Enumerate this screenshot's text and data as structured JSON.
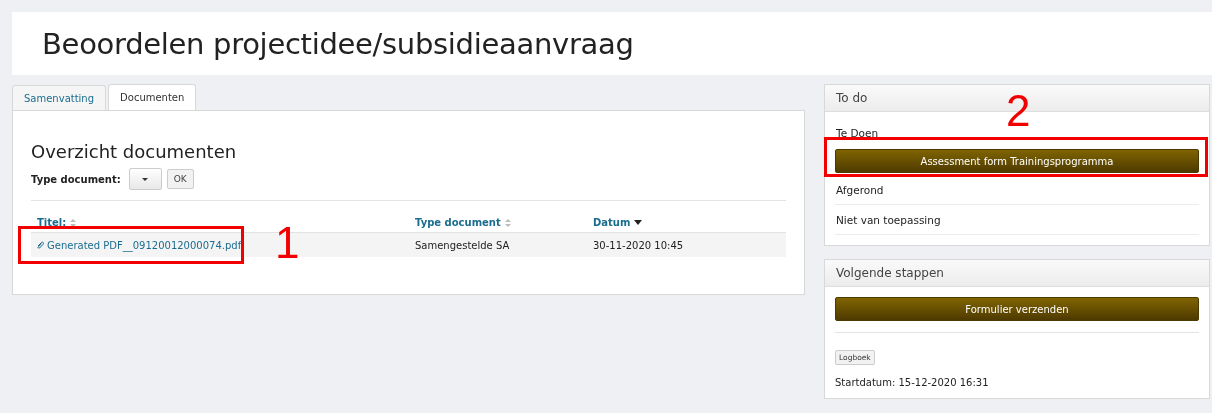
{
  "page_title": "Beoordelen projectidee/subsidieaanvraag",
  "tabs": [
    {
      "label": "Samenvatting",
      "selected": false
    },
    {
      "label": "Documenten",
      "selected": true
    }
  ],
  "documents": {
    "heading": "Overzicht documenten",
    "filter_label": "Type document:",
    "filter_button": "OK",
    "columns": [
      {
        "label": "Titel:",
        "sorted": false
      },
      {
        "label": "Type document",
        "sorted": false
      },
      {
        "label": "Datum",
        "sorted": true
      }
    ],
    "rows": [
      {
        "title": "Generated PDF__09120012000074.pdf",
        "type": "Samengestelde SA",
        "date": "30-11-2020 10:45",
        "callout": "1"
      }
    ]
  },
  "todo": {
    "title": "To do",
    "items": [
      {
        "kind": "label",
        "text": "Te Doen"
      },
      {
        "kind": "button",
        "text": "Assessment form Trainingsprogramma",
        "callout": "2"
      },
      {
        "kind": "label",
        "text": "Afgerond"
      },
      {
        "kind": "label",
        "text": "Niet van toepassing"
      }
    ]
  },
  "next_steps": {
    "title": "Volgende stappen",
    "submit": "Formulier verzenden",
    "log_button": "Logboek",
    "start_label": "Startdatum: 15-12-2020 16:31"
  }
}
